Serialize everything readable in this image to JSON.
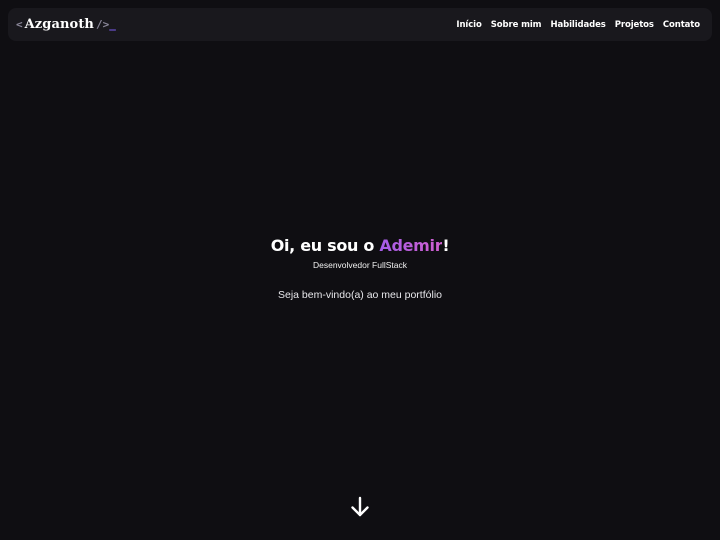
{
  "logo": {
    "open_bracket": "<",
    "name": "Azganoth",
    "close_bracket": "/>",
    "cursor": "_"
  },
  "nav": {
    "items": [
      {
        "label": "Início"
      },
      {
        "label": "Sobre mim"
      },
      {
        "label": "Habilidades"
      },
      {
        "label": "Projetos"
      },
      {
        "label": "Contato"
      }
    ]
  },
  "hero": {
    "greeting_prefix": "Oi, eu sou o ",
    "name": "Ademir",
    "greeting_suffix": "!",
    "subtitle": "Desenvolvedor FullStack",
    "welcome": "Seja bem-vindo(a) ao meu portfólio"
  },
  "icons": {
    "scroll_down": "arrow-down-icon"
  },
  "colors": {
    "background": "#0f0e12",
    "navbar": "#19181d",
    "accent_start": "#a45de8",
    "accent_end": "#d15fcf",
    "cursor": "#7c5cf0"
  }
}
